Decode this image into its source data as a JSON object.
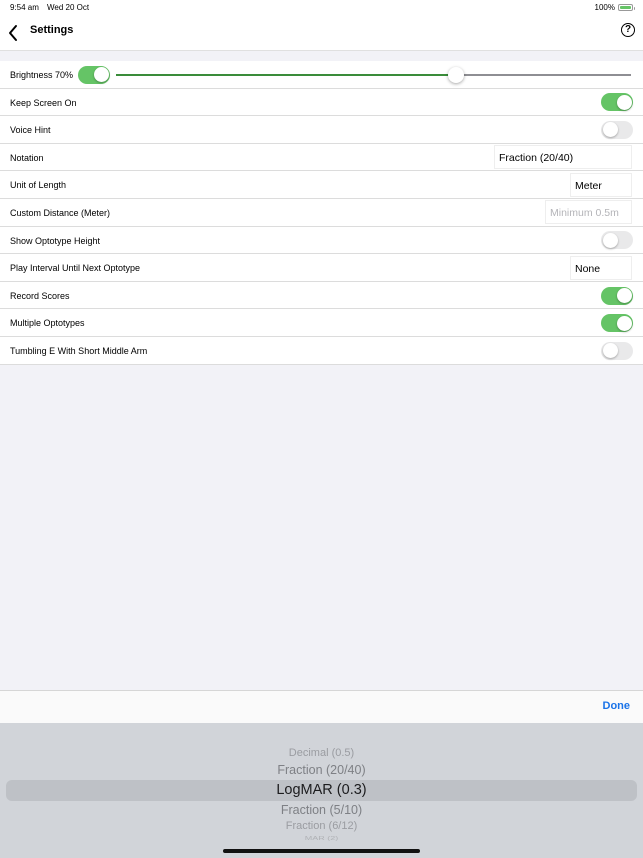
{
  "status_bar": {
    "time": "9:54 am",
    "date": "Wed 20 Oct",
    "battery_percent": "100%",
    "battery_level": 1.0
  },
  "nav": {
    "title": "Settings",
    "back_icon": "chevron-left-icon",
    "help_icon": "question-circle-icon",
    "help_glyph": "?"
  },
  "settings": {
    "brightness": {
      "label": "Brightness 70%",
      "enabled": true,
      "slider_fraction": 0.66
    },
    "keep_screen_on": {
      "label": "Keep Screen On",
      "on": true
    },
    "voice_hint": {
      "label": "Voice Hint",
      "on": false
    },
    "notation": {
      "label": "Notation",
      "value": "Fraction (20/40)"
    },
    "unit_of_length": {
      "label": "Unit of Length",
      "value": "Meter"
    },
    "custom_distance": {
      "label": "Custom Distance (Meter)",
      "value": "",
      "placeholder": "Minimum 0.5m"
    },
    "show_optotype_height": {
      "label": "Show Optotype Height",
      "on": false
    },
    "play_interval": {
      "label": "Play Interval Until Next Optotype",
      "value": "None"
    },
    "record_scores": {
      "label": "Record Scores",
      "on": true
    },
    "multiple_optotypes": {
      "label": "Multiple Optotypes",
      "on": true
    },
    "tumbling_e": {
      "label": "Tumbling E With Short Middle Arm",
      "on": false
    }
  },
  "picker": {
    "done_label": "Done",
    "options": [
      "Decimal (0.5)",
      "Fraction (20/40)",
      "LogMAR (0.3)",
      "Fraction (5/10)",
      "Fraction (6/12)",
      "MAR (2)"
    ],
    "selected_index": 2
  },
  "colors": {
    "toggle_on": "#65c466",
    "slider_fill": "#3a8c3a",
    "accent": "#1a73e8"
  }
}
